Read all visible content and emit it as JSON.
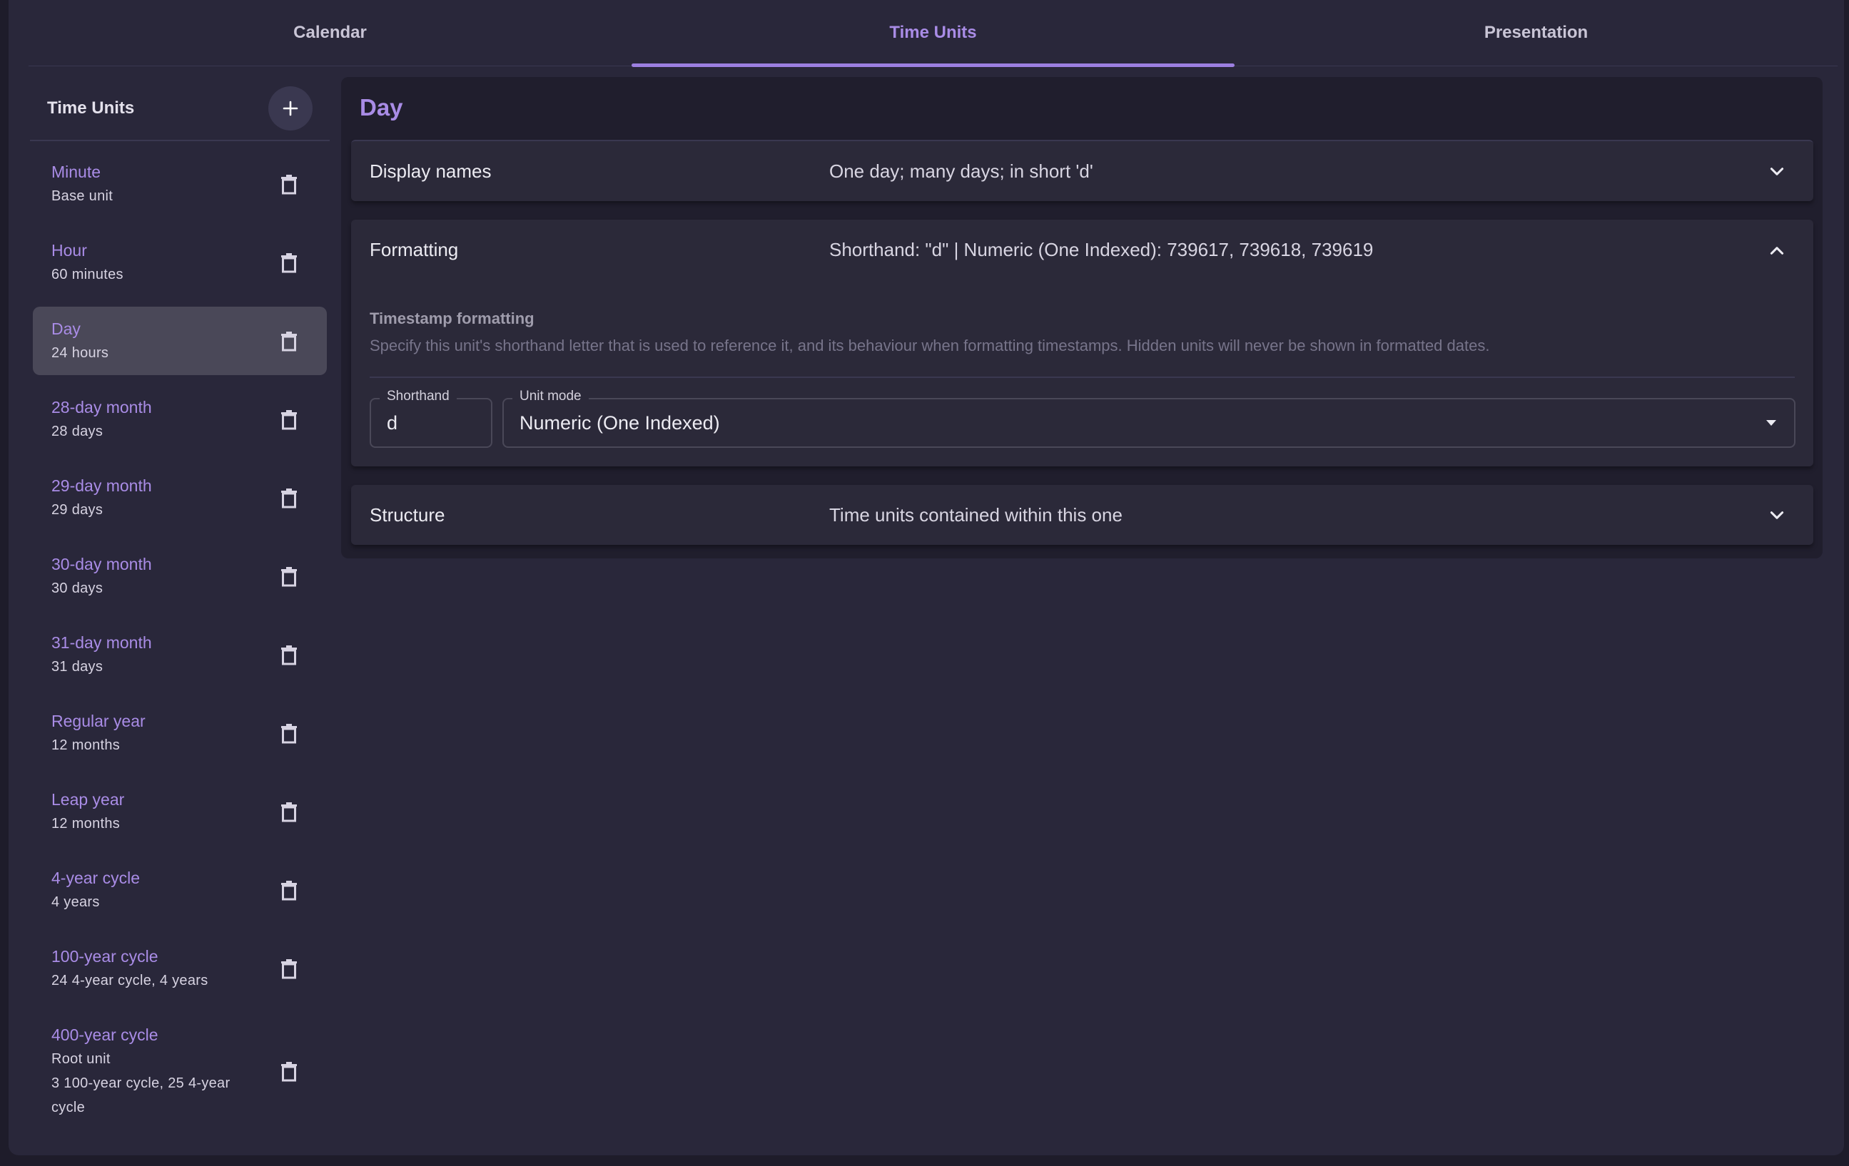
{
  "tabs": [
    {
      "label": "Calendar",
      "active": false
    },
    {
      "label": "Time Units",
      "active": true
    },
    {
      "label": "Presentation",
      "active": false
    }
  ],
  "sidebar": {
    "title": "Time Units",
    "add_icon": "plus-icon",
    "items": [
      {
        "name": "Minute",
        "desc": [
          "Base unit"
        ],
        "selected": false
      },
      {
        "name": "Hour",
        "desc": [
          "60 minutes"
        ],
        "selected": false
      },
      {
        "name": "Day",
        "desc": [
          "24 hours"
        ],
        "selected": true
      },
      {
        "name": "28-day month",
        "desc": [
          "28 days"
        ],
        "selected": false
      },
      {
        "name": "29-day month",
        "desc": [
          "29 days"
        ],
        "selected": false
      },
      {
        "name": "30-day month",
        "desc": [
          "30 days"
        ],
        "selected": false
      },
      {
        "name": "31-day month",
        "desc": [
          "31 days"
        ],
        "selected": false
      },
      {
        "name": "Regular year",
        "desc": [
          "12 months"
        ],
        "selected": false
      },
      {
        "name": "Leap year",
        "desc": [
          "12 months"
        ],
        "selected": false
      },
      {
        "name": "4-year cycle",
        "desc": [
          "4 years"
        ],
        "selected": false
      },
      {
        "name": "100-year cycle",
        "desc": [
          "24 4-year cycle, 4 years"
        ],
        "selected": false
      },
      {
        "name": "400-year cycle",
        "desc": [
          "Root unit",
          "3 100-year cycle, 25 4-year cycle"
        ],
        "selected": false
      }
    ]
  },
  "main": {
    "title": "Day",
    "display_names": {
      "label": "Display names",
      "summary": "One day; many days; in short 'd'",
      "expanded": false
    },
    "formatting": {
      "label": "Formatting",
      "summary": "Shorthand: \"d\" | Numeric (One Indexed): 739617, 739618, 739619",
      "expanded": true,
      "section_title": "Timestamp formatting",
      "section_desc": "Specify this unit's shorthand letter that is used to reference it, and its behaviour when formatting timestamps. Hidden units will never be shown in formatted dates.",
      "shorthand_label": "Shorthand",
      "shorthand_value": "d",
      "unit_mode_label": "Unit mode",
      "unit_mode_value": "Numeric (One Indexed)"
    },
    "structure": {
      "label": "Structure",
      "summary": "Time units contained within this one",
      "expanded": false
    }
  },
  "colors": {
    "accent": "#a98ce6",
    "background": "#29273a",
    "panel": "#201e2d",
    "selected_item": "#4a4858"
  }
}
